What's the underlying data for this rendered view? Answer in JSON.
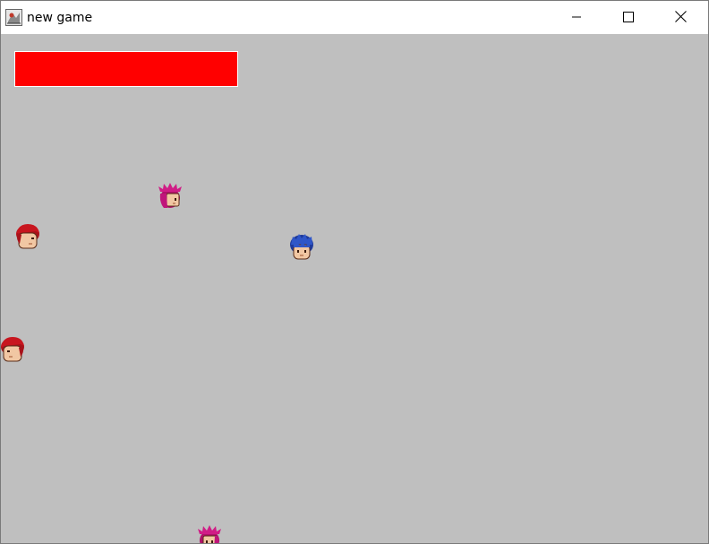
{
  "window": {
    "title": "new game",
    "icon": "java-app-icon",
    "controls": [
      "minimize-icon",
      "maximize-icon",
      "close-icon"
    ]
  },
  "game": {
    "background_color": "#bfbfbf",
    "health_bar": {
      "fill_fraction": 1.0,
      "fill_color": "#ff0000"
    },
    "player": {
      "kind": "blue-haired-hero"
    },
    "enemies": [
      {
        "kind": "pink-haired"
      },
      {
        "kind": "red-haired"
      },
      {
        "kind": "red-haired"
      },
      {
        "kind": "pink-haired"
      }
    ]
  }
}
